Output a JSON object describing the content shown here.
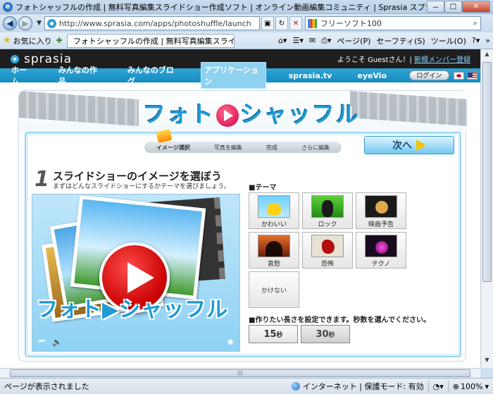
{
  "window": {
    "title": "フォトシャッフルの作成 | 無料写真編集スライドショー作成ソフト | オンライン動画編集コミュニティ | Sprasia スプラシア - Windows Internet E...",
    "btn_min": "－",
    "btn_max": "□",
    "btn_close": "✕"
  },
  "address": {
    "url": "http://www.sprasia.com/apps/photoshuffle/launch",
    "search_text": "フリーソフト100"
  },
  "favbar": {
    "favorites": "お気に入り",
    "tab_title": "フォトシャッフルの作成 | 無料写真編集スライ...",
    "tools": [
      "ページ(P)",
      "セーフティ(S)",
      "ツール(O)"
    ]
  },
  "site": {
    "logo": "sprasia",
    "welcome_prefix": "ようこそ Guestさん！|",
    "register": "新規メンバー登録",
    "nav": [
      "ホーム",
      "みんなの作品",
      "みんなのブログ",
      "アプリケーション",
      "sprasia.tv",
      "eyeVio"
    ],
    "active_nav": "アプリケーション",
    "login": "ログイン"
  },
  "app": {
    "title_left": "フォト",
    "title_right": "シャッフル",
    "steps": [
      "イメージ選択",
      "写真を編集",
      "完成",
      "さらに編集"
    ],
    "next": "次へ",
    "step_number": "1",
    "heading": "スライドショーのイメージを選ぼう",
    "subheading": "まずはどんなスライドショーにするかテーマを選びましょう。",
    "preview_title": "フォト▶シャッフル",
    "theme_label": "■テーマ",
    "themes": [
      "かわいい",
      "ロック",
      "映画予告",
      "哀愁",
      "恐怖",
      "テクノ",
      "かけない"
    ],
    "duration_label": "■作りたい長さを設定できます。秒数を選んでください。",
    "durations": [
      {
        "value": "15",
        "unit": "秒"
      },
      {
        "value": "30",
        "unit": "秒"
      }
    ]
  },
  "status": {
    "left": "ページが表示されました",
    "zone": "インターネット | 保護モード: 有効",
    "zoom": "100%"
  },
  "colors": {
    "brand_blue": "#1e9bd7",
    "nav_blue": "#178bc0",
    "play_red": "#c80000"
  }
}
